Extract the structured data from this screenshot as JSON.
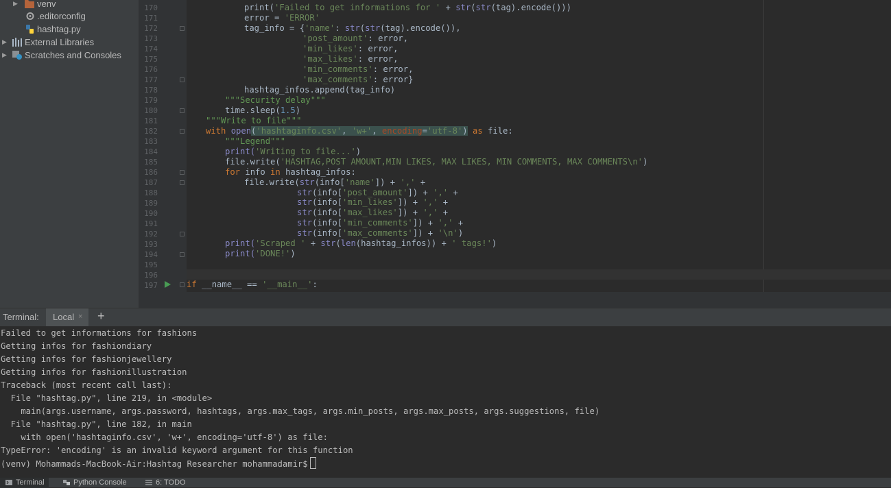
{
  "project_tree": [
    {
      "label": "venv",
      "icon": "folder-icon",
      "expandable": true
    },
    {
      "label": ".editorconfig",
      "icon": "editorconfig-file-icon",
      "expandable": false
    },
    {
      "label": "hashtag.py",
      "icon": "python-file-icon",
      "expandable": false
    },
    {
      "label": "External Libraries",
      "icon": "library-icon",
      "expandable": true
    },
    {
      "label": "Scratches and Consoles",
      "icon": "scratches-icon",
      "expandable": true
    }
  ],
  "editor": {
    "lines": [
      {
        "no": "170"
      },
      {
        "no": "171"
      },
      {
        "no": "172"
      },
      {
        "no": "173"
      },
      {
        "no": "174"
      },
      {
        "no": "175"
      },
      {
        "no": "176"
      },
      {
        "no": "177"
      },
      {
        "no": "178"
      },
      {
        "no": "179"
      },
      {
        "no": "180"
      },
      {
        "no": "181"
      },
      {
        "no": "182"
      },
      {
        "no": "183"
      },
      {
        "no": "184"
      },
      {
        "no": "185"
      },
      {
        "no": "186"
      },
      {
        "no": "187"
      },
      {
        "no": "188"
      },
      {
        "no": "189"
      },
      {
        "no": "190"
      },
      {
        "no": "191"
      },
      {
        "no": "192"
      },
      {
        "no": "193"
      },
      {
        "no": "194"
      },
      {
        "no": "195"
      },
      {
        "no": "196"
      },
      {
        "no": "197"
      }
    ],
    "code": {
      "l170_a": "print(",
      "l170_b": "'Failed to get informations for '",
      "l170_c": " + ",
      "l170_d": "str",
      "l170_e": "(",
      "l170_f": "str",
      "l170_g": "(tag).encode()))",
      "l171_a": "error = ",
      "l171_b": "'ERROR'",
      "l172_a": "tag_info = {",
      "l172_b": "'name'",
      "l172_c": ": ",
      "l172_d": "str",
      "l172_e": "(",
      "l172_f": "str",
      "l172_g": "(tag).encode()),",
      "l173_a": "'post_amount'",
      "l173_b": ": error,",
      "l174_a": "'min_likes'",
      "l174_b": ": error,",
      "l175_a": "'max_likes'",
      "l175_b": ": error,",
      "l176_a": "'min_comments'",
      "l176_b": ": error,",
      "l177_a": "'max_comments'",
      "l177_b": ": error}",
      "l178": "hashtag_infos.append(tag_info)",
      "l179": "\"\"\"Security delay\"\"\"",
      "l180_a": "time.sleep(",
      "l180_b": "1.5",
      "l180_c": ")",
      "l181": "\"\"\"Write to file\"\"\"",
      "l182_a": "with ",
      "l182_b": "open",
      "l182_c": "(",
      "l182_d": "'hashtaginfo.csv'",
      "l182_e": ", ",
      "l182_f": "'w+'",
      "l182_g": ", ",
      "l182_h": "encoding",
      "l182_i": "=",
      "l182_j": "'utf-8'",
      "l182_k": ")",
      "l182_l": " as ",
      "l182_m": "file:",
      "l183": "\"\"\"Legend\"\"\"",
      "l184_a": "print(",
      "l184_b": "'Writing to file...'",
      "l184_c": ")",
      "l185_a": "file.write(",
      "l185_b": "'HASHTAG,POST AMOUNT,MIN LIKES, MAX LIKES, MIN COMMENTS, MAX COMMENTS\\n'",
      "l185_c": ")",
      "l186_a": "for ",
      "l186_b": "info ",
      "l186_c": "in ",
      "l186_d": "hashtag_infos:",
      "l187_a": "file.write(",
      "l187_b": "str",
      "l187_c": "(info[",
      "l187_d": "'name'",
      "l187_e": "]) + ",
      "l187_f": "','",
      "l187_g": " +",
      "l188_a": "str",
      "l188_b": "(info[",
      "l188_c": "'post_amount'",
      "l188_d": "]) + ",
      "l188_e": "','",
      "l188_f": " +",
      "l189_a": "str",
      "l189_b": "(info[",
      "l189_c": "'min_likes'",
      "l189_d": "]) + ",
      "l189_e": "','",
      "l189_f": " +",
      "l190_a": "str",
      "l190_b": "(info[",
      "l190_c": "'max_likes'",
      "l190_d": "]) + ",
      "l190_e": "','",
      "l190_f": " +",
      "l191_a": "str",
      "l191_b": "(info[",
      "l191_c": "'min_comments'",
      "l191_d": "]) + ",
      "l191_e": "','",
      "l191_f": " +",
      "l192_a": "str",
      "l192_b": "(info[",
      "l192_c": "'max_comments'",
      "l192_d": "]) + ",
      "l192_e": "'\\n'",
      "l192_f": ")",
      "l193_a": "print(",
      "l193_b": "'Scraped '",
      "l193_c": " + ",
      "l193_d": "str",
      "l193_e": "(",
      "l193_f": "len",
      "l193_g": "(hashtag_infos)) + ",
      "l193_h": "' tags!'",
      "l193_i": ")",
      "l194_a": "print(",
      "l194_b": "'DONE!'",
      "l194_c": ")",
      "l197_a": "if ",
      "l197_b": "__name__ == ",
      "l197_c": "'__main__'",
      "l197_d": ":"
    }
  },
  "terminal": {
    "title": "Terminal:",
    "tab_label": "Local",
    "close_glyph": "×",
    "new_tab_glyph": "+",
    "lines": [
      "Failed to get informations for fashions",
      "Getting infos for fashiondiary",
      "Getting infos for fashionjewellery",
      "Getting infos for fashionillustration",
      "Traceback (most recent call last):",
      "  File \"hashtag.py\", line 219, in <module>",
      "    main(args.username, args.password, hashtags, args.max_tags, args.min_posts, args.max_posts, args.suggestions, file)",
      "  File \"hashtag.py\", line 182, in main",
      "    with open('hashtaginfo.csv', 'w+', encoding='utf-8') as file:",
      "TypeError: 'encoding' is an invalid keyword argument for this function"
    ],
    "prompt": "(venv) Mohammads-MacBook-Air:Hashtag Researcher mohammadamir$"
  },
  "bottom_bar": {
    "tabs": [
      {
        "label": "Terminal",
        "icon": "terminal-icon",
        "active": true
      },
      {
        "label": "Python Console",
        "icon": "python-console-icon",
        "active": false
      },
      {
        "label": "6: TODO",
        "icon": "todo-icon",
        "active": false
      }
    ]
  },
  "colors": {
    "editor_bg": "#2b2b2b",
    "sidebar_bg": "#3c3f41",
    "keyword": "#cc7832",
    "string": "#6a8759",
    "number": "#6897bb",
    "builtin": "#8888c6",
    "docstring": "#629755"
  }
}
